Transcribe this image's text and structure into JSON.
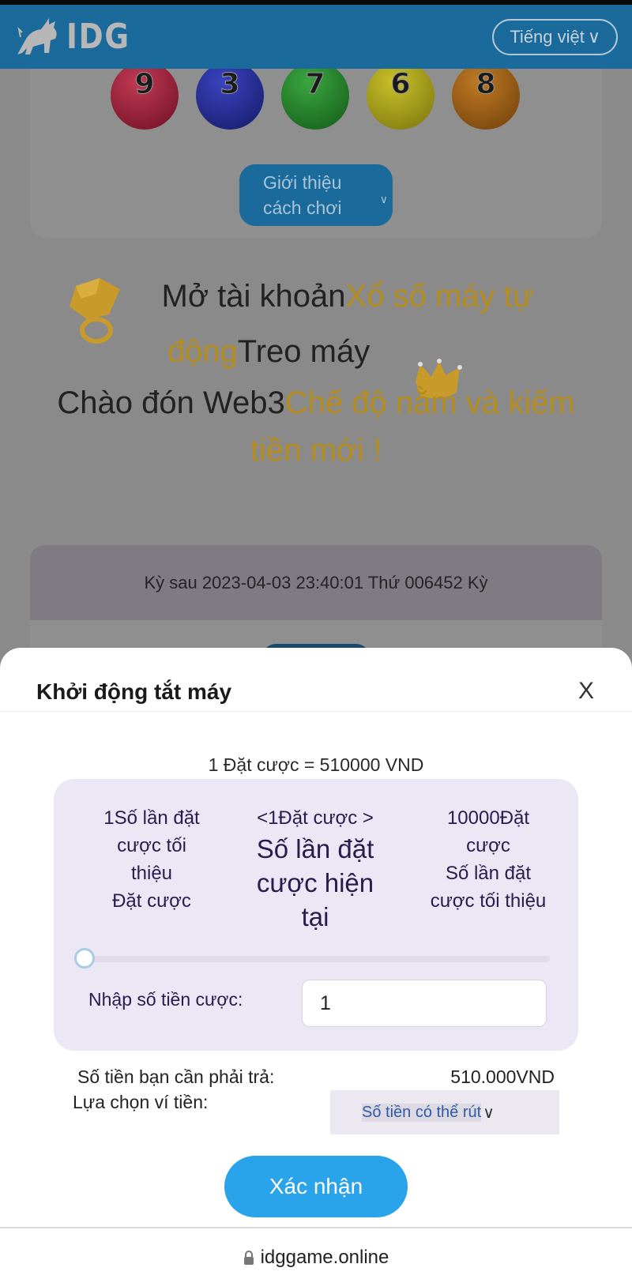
{
  "header": {
    "logo_text": "IDG",
    "language_label": "Tiếng việt",
    "language_chevron": "∨"
  },
  "results": {
    "balls": [
      {
        "number": "9",
        "color": "#8a1a30"
      },
      {
        "number": "3",
        "color": "#232a8c"
      },
      {
        "number": "7",
        "color": "#1f7a25"
      },
      {
        "number": "6",
        "color": "#9c9415"
      },
      {
        "number": "8",
        "color": "#8e5a14"
      }
    ],
    "intro_button": {
      "line1": "Giới thiệu",
      "line2": "cách chơi",
      "chevron": "∨"
    }
  },
  "promo": {
    "line1_dark": "Mở tài khoản",
    "line1_gold": "Xổ số máy tự",
    "line2_gold": "động",
    "line2_dark": "Treo máy",
    "line3_dark": "Chào đón Web3",
    "line3_gold": "Chế độ nằm và kiếm",
    "line4_gold": "tiền mới !"
  },
  "period": {
    "text": "Kỳ sau 2023-04-03 23:40:01 Thứ 006452 Kỳ"
  },
  "sheet": {
    "title": "Khởi động tắt máy",
    "close_label": "X",
    "rate_text": "1 Đặt cược = 510000 VND",
    "min_col": [
      "1Số lần đặt",
      "cược tối",
      "thiệu",
      "Đặt cược"
    ],
    "current_col": {
      "top": "<1Đặt cược >",
      "lines": [
        "Số lần đặt",
        "cược hiện",
        "tại"
      ]
    },
    "max_col": [
      "10000Đặt",
      "cược",
      "Số lần đặt",
      "cược tối thiệu"
    ],
    "slider": {
      "value": 1,
      "min": 1,
      "max": 10000
    },
    "bet_input_label": "Nhập số tiền cược:",
    "bet_input_value": "1",
    "pay_label": "Số tiền bạn cần phải trả:",
    "pay_value": "510.000VND",
    "wallet_label": "Lựa chọn ví tiền:",
    "wallet_selected": "Số tiền có thể rút",
    "wallet_chevron": "∨",
    "confirm_label": "Xác nhận"
  },
  "browser": {
    "url": "idggame.online"
  },
  "colors": {
    "header": "#1a6a9c",
    "confirm": "#29a3ea",
    "gold": "#b58c1e",
    "bet_box": "#ece7f5"
  }
}
